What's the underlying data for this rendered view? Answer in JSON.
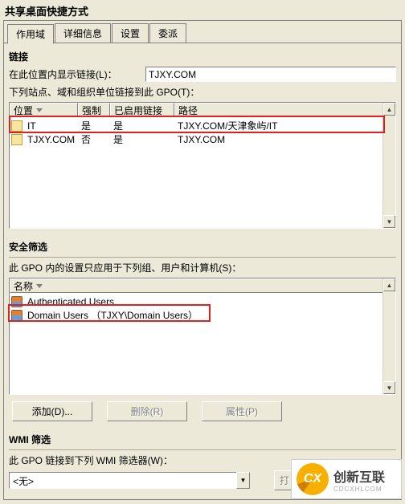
{
  "title": "共享桌面快捷方式",
  "tabs": [
    "作用域",
    "详细信息",
    "设置",
    "委派"
  ],
  "links": {
    "heading": "链接",
    "show_in_label": "在此位置内显示链接(L)：",
    "show_in_value": "TJXY.COM",
    "linked_label": "下列站点、域和组织单位链接到此 GPO(T)：",
    "columns": {
      "c0": "位置",
      "c1": "强制",
      "c2": "已启用链接",
      "c3": "路径"
    },
    "rows": [
      {
        "loc": "IT",
        "force": "是",
        "enabled": "是",
        "path": "TJXY.COM/天津象屿/IT"
      },
      {
        "loc": "TJXY.COM",
        "force": "否",
        "enabled": "是",
        "path": "TJXY.COM"
      }
    ]
  },
  "security": {
    "heading": "安全筛选",
    "desc": "此 GPO 内的设置只应用于下列组、用户和计算机(S)：",
    "col_name": "名称",
    "rows": [
      {
        "name": "Authenticated Users"
      },
      {
        "name": "Domain Users （TJXY\\Domain Users）"
      }
    ],
    "btn_add": "添加(D)...",
    "btn_remove": "删除(R)",
    "btn_props": "属性(P)"
  },
  "wmi": {
    "heading": "WMI 筛选",
    "desc": "此 GPO 链接到下列 WMI 筛选器(W)：",
    "value": "<无>",
    "btn_open": "打"
  },
  "logo": {
    "glyph": "CX",
    "text": "创新互联",
    "sub": "CDCXHLCOM"
  }
}
